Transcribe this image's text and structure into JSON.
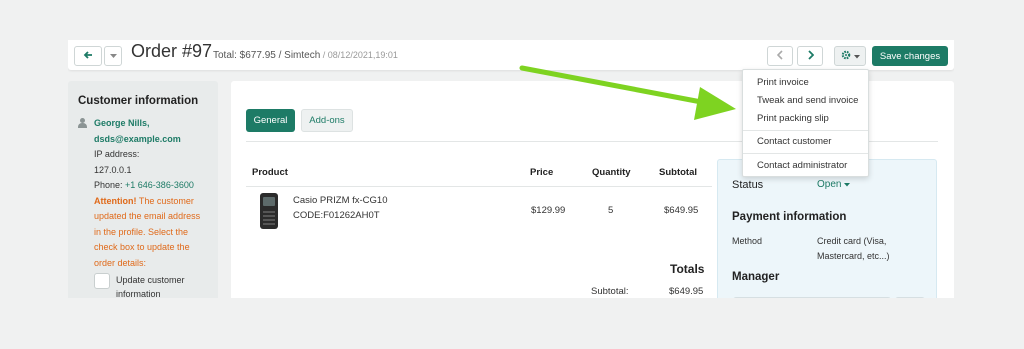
{
  "header": {
    "back_icon": "arrow-left-icon",
    "order_title": "Order #97",
    "total_text": "Total: $677.95 / Simtech",
    "date_text": " / 08/12/2021,19:01",
    "gear_icon": "gear-icon",
    "save_label": "Save changes"
  },
  "customer": {
    "heading": "Customer information",
    "name": "George Nills,",
    "email": "dsds@example.com",
    "ip_label": "IP address:",
    "ip_value": "127.0.0.1",
    "phone_label": "Phone: ",
    "phone_value": "+1 646-386-3600",
    "attention_label": "Attention!",
    "attention_text": " The customer updated the email address in the profile. Select the check box to update the order details:",
    "checkbox_label": "Update customer information"
  },
  "tabs": [
    {
      "label": "General",
      "active": true
    },
    {
      "label": "Add-ons",
      "active": false
    }
  ],
  "table": {
    "headers": {
      "product": "Product",
      "price": "Price",
      "quantity": "Quantity",
      "subtotal": "Subtotal"
    },
    "rows": [
      {
        "name": "Casio PRIZM fx-CG10",
        "code": "CODE:F01262AH0T",
        "price": "$129.99",
        "quantity": "5",
        "subtotal": "$649.95"
      }
    ]
  },
  "totals": {
    "heading": "Totals",
    "subtotal_label": "Subtotal:",
    "subtotal_value": "$649.95"
  },
  "status_panel": {
    "status_label": "Status",
    "status_value": "Open",
    "payment_heading": "Payment information",
    "method_label": "Method",
    "method_value_1": "Credit card (Visa,",
    "method_value_2": "Mastercard, etc...)",
    "manager_heading": "Manager"
  },
  "dropdown": {
    "items": [
      "Print invoice",
      "Tweak and send invoice",
      "Print packing slip",
      "Contact customer",
      "Contact administrator"
    ]
  },
  "colors": {
    "accent": "#1d7b66",
    "warning": "#e06a1a",
    "annotation_arrow": "#7ed321"
  }
}
